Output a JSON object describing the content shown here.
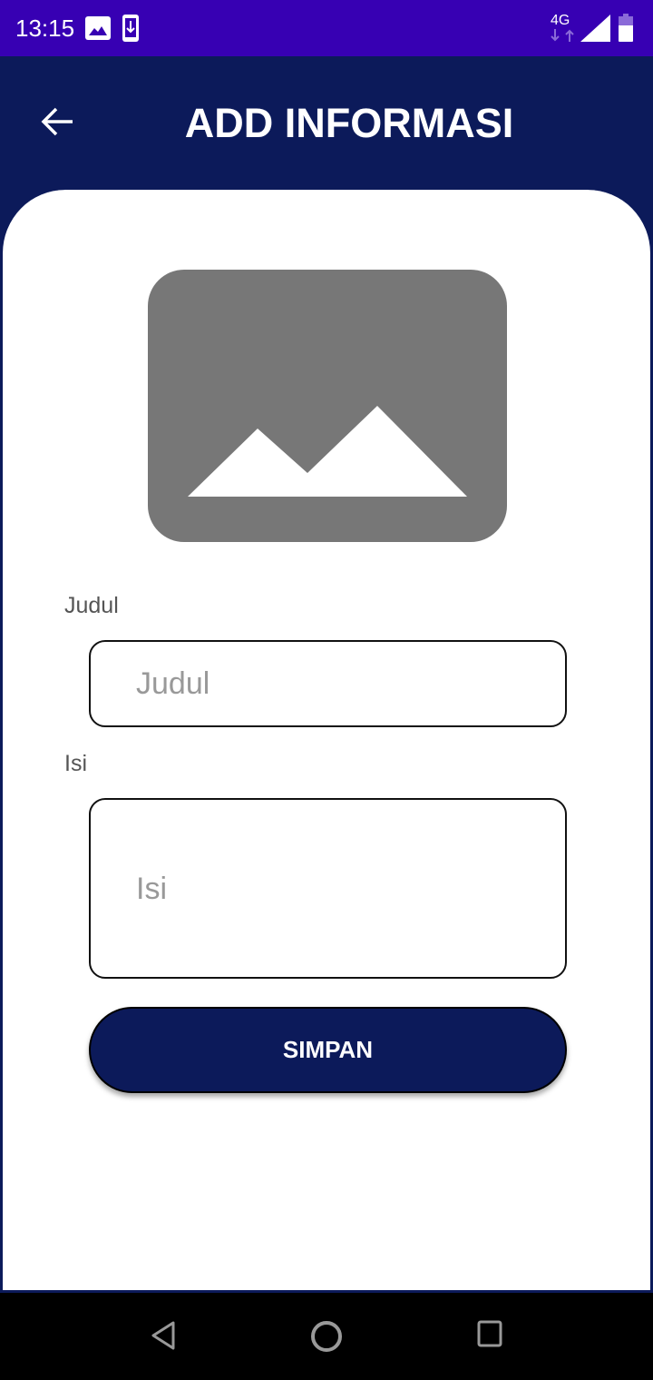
{
  "status": {
    "time": "13:15",
    "network": "4G"
  },
  "header": {
    "title": "ADD INFORMASI"
  },
  "form": {
    "judul_label": "Judul",
    "judul_placeholder": "Judul",
    "isi_label": "Isi",
    "isi_placeholder": "Isi",
    "save_label": "SIMPAN"
  },
  "colors": {
    "primary": "#0c1a5a",
    "status_bar": "#3700b3"
  }
}
